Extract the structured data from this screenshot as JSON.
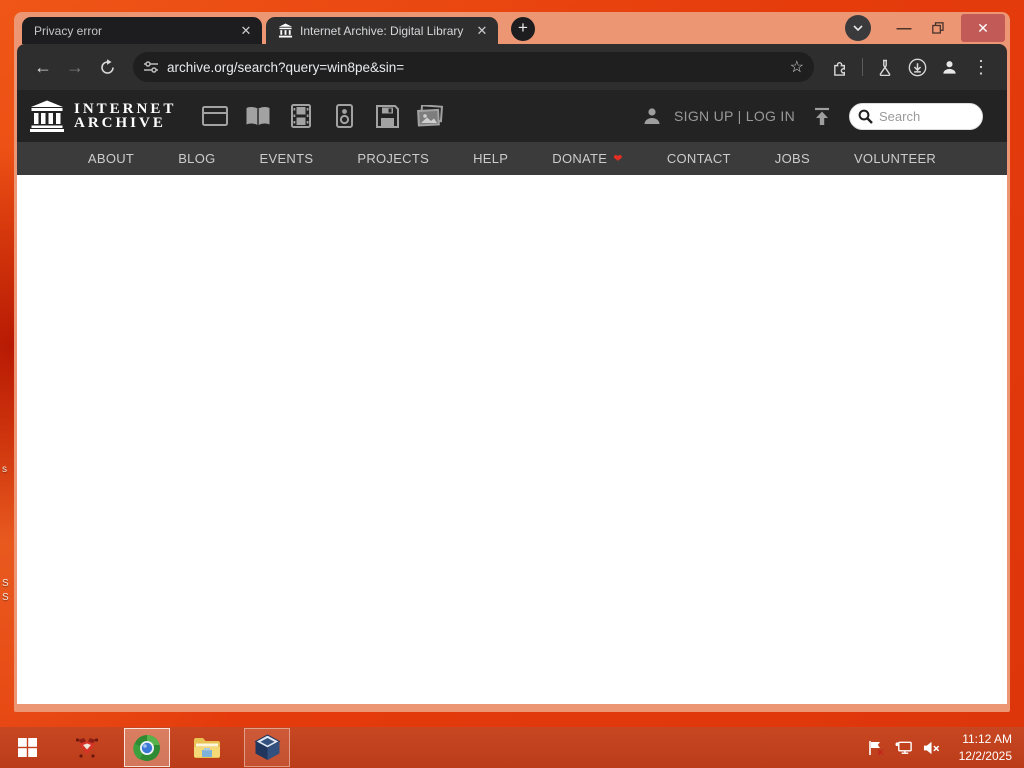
{
  "window": {
    "tabs": [
      {
        "title": "Privacy error"
      },
      {
        "title": "Internet Archive: Digital Library"
      }
    ],
    "new_tab_label": "+",
    "close_glyph": "✕",
    "minimize_glyph": "—",
    "address": "archive.org/search?query=win8pe&sin="
  },
  "archive_header": {
    "logo_line1": "INTERNET",
    "logo_line2": "ARCHIVE",
    "auth_text": "SIGN UP | LOG IN",
    "search_placeholder": "Search",
    "media_types": [
      "web",
      "texts",
      "video",
      "audio",
      "software",
      "images"
    ],
    "nav_items": [
      "ABOUT",
      "BLOG",
      "EVENTS",
      "PROJECTS",
      "HELP",
      "DONATE",
      "CONTACT",
      "JOBS",
      "VOLUNTEER"
    ]
  },
  "taskbar": {
    "time": "11:12 AM",
    "date": "12/2/2025"
  },
  "desktop": {
    "icon_label_fragments": [
      "s",
      "S",
      "S"
    ]
  },
  "colors": {
    "desktop_orange": "#e63c0c",
    "frame_salmon": "#ec9673",
    "toolbar_dark": "#2e2e2e",
    "omnibox_dark": "#1f1f20",
    "ia_header": "#232323",
    "ia_nav": "#3b3b3b",
    "taskbar_red": "#bb3c1a",
    "close_button_red": "#c25b57",
    "donate_heart_red": "#e62e24"
  }
}
